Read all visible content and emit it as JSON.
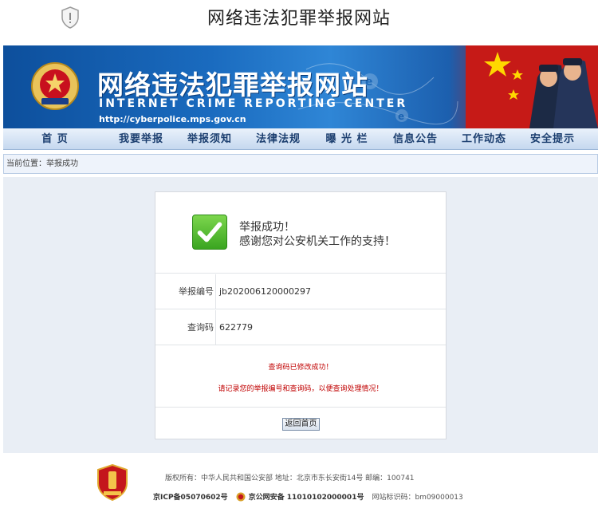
{
  "browser": {
    "title": "网络违法犯罪举报网站",
    "security_icon": "shield-exclamation-icon"
  },
  "banner": {
    "title_cn": "网络违法犯罪举报网站",
    "title_en": "INTERNET CRIME REPORTING CENTER",
    "url": "http://cyberpolice.mps.gov.cn"
  },
  "nav": {
    "items": [
      "首 页",
      "我要举报",
      "举报须知",
      "法律法规",
      "曝 光 栏",
      "信息公告",
      "工作动态",
      "安全提示"
    ]
  },
  "breadcrumb": "当前位置：举报成功",
  "result": {
    "status_icon": "check-icon",
    "line1": "举报成功！",
    "line2": "感谢您对公安机关工作的支持！",
    "report_no_label": "举报编号",
    "report_no": "jb202006120000297",
    "query_code_label": "查询码",
    "query_code": "622779",
    "msg1": "查询码已修改成功！",
    "msg2": "请记录您的举报编号和查询码，以便查询处理情况！",
    "back_button": "返回首页"
  },
  "footer": {
    "copyright": "版权所有：中华人民共和国公安部   地址：北京市东长安街14号   邮编：100741",
    "icp": "京ICP备05070602号",
    "police_record": "京公网安备 11010102000001号",
    "site_id": "网站标识码：bm09000013"
  },
  "colors": {
    "banner_blue": "#1a6bbf",
    "nav_text": "#1b3e6f",
    "notice_red": "#c00000",
    "success_green": "#3aa520"
  }
}
